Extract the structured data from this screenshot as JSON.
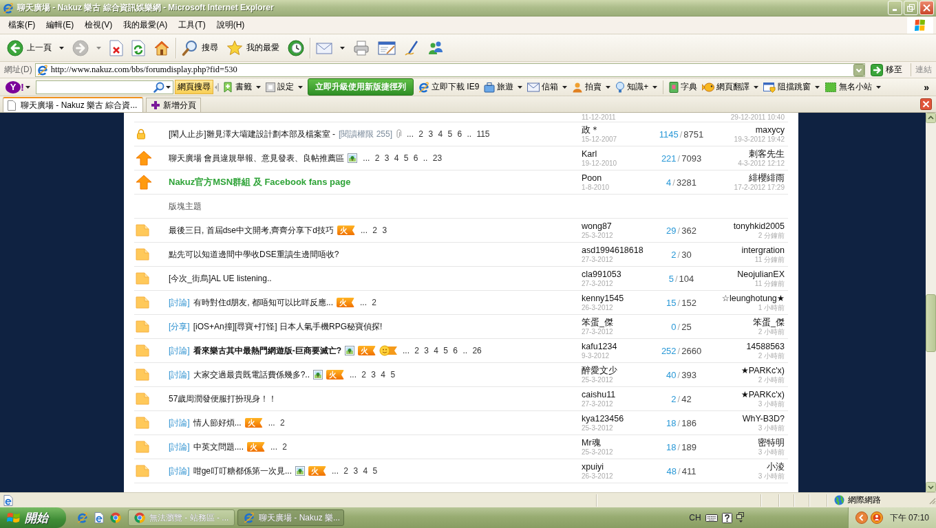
{
  "window": {
    "title": "聊天廣場 - Nakuz 樂古 綜合資訊娛樂網 - Microsoft Internet Explorer"
  },
  "menu_bar": {
    "items": [
      "檔案(F)",
      "編輯(E)",
      "檢視(V)",
      "我的最愛(A)",
      "工具(T)",
      "說明(H)"
    ]
  },
  "toolbar": {
    "groups": [
      [
        {
          "kind": "back",
          "label": "上一頁",
          "dropdown": true,
          "disabled": false
        },
        {
          "kind": "forward",
          "dropdown": true,
          "disabled": true
        },
        {
          "kind": "stop",
          "dropdown": false,
          "disabled": false
        },
        {
          "kind": "refresh",
          "dropdown": false,
          "disabled": false
        },
        {
          "kind": "home",
          "dropdown": false,
          "disabled": false
        }
      ],
      [
        {
          "kind": "search",
          "label": "搜尋",
          "dropdown": false,
          "disabled": false
        },
        {
          "kind": "favorites",
          "label": "我的最愛",
          "dropdown": false,
          "disabled": false
        },
        {
          "kind": "history",
          "dropdown": false,
          "disabled": false
        }
      ],
      [
        {
          "kind": "mail",
          "dropdown": true,
          "disabled": false
        },
        {
          "kind": "print",
          "dropdown": false,
          "disabled": false
        },
        {
          "kind": "edit",
          "dropdown": false,
          "disabled": false
        },
        {
          "kind": "discuss",
          "dropdown": false,
          "disabled": false
        },
        {
          "kind": "messenger",
          "dropdown": false,
          "disabled": false
        }
      ]
    ]
  },
  "address_bar": {
    "label": "網址(D)",
    "url": "http://www.nakuz.com/bbs/forumdisplay.php?fid=530",
    "go": "移至",
    "links": "連結"
  },
  "yahoo_toolbar": {
    "logo_letter": "Y",
    "logo_mark": "!",
    "search_button": "網頁搜尋",
    "groups": [
      [
        {
          "kind": "bookmarks",
          "label": "書籤",
          "dropdown": true
        },
        {
          "kind": "settings",
          "label": "設定",
          "dropdown": true
        },
        {
          "kind": "upgrade",
          "label": "立即升級使用新版捷徑列",
          "dropdown": false
        },
        {
          "kind": "ie9",
          "label": "立即下載 IE9",
          "dropdown": false
        },
        {
          "kind": "travel",
          "label": "旅遊",
          "dropdown": true
        },
        {
          "kind": "mail",
          "label": "信箱",
          "dropdown": true
        },
        {
          "kind": "auction",
          "label": "拍賣",
          "dropdown": true
        },
        {
          "kind": "knowledge",
          "label": "知識+",
          "dropdown": true
        }
      ],
      [
        {
          "kind": "dictionary",
          "label": "字典",
          "dropdown": false
        },
        {
          "kind": "translate",
          "label": "網頁翻譯",
          "dropdown": true
        },
        {
          "kind": "popup_blocker",
          "label": "阻擋跳窗",
          "dropdown": true
        },
        {
          "kind": "blog",
          "label": "無名小站",
          "dropdown": true
        }
      ]
    ],
    "more": "»"
  },
  "tab_bar": {
    "tabs": [
      {
        "label": "聊天廣場 - Nakuz 樂古 綜合資...",
        "selected": true
      }
    ],
    "new_tab": "新增分頁"
  },
  "forum": {
    "rows": [
      {
        "kind": "partial",
        "author_date": "11-12-2011",
        "last_time": "29-12-2011 10:40"
      },
      {
        "kind": "locked",
        "title": "[閑人止步]雛見澤大壩建設計劃本部及檔案室 -",
        "note": "[閱讀權限 255]",
        "badges": [
          {
            "kind": "attachment"
          }
        ],
        "pages": "... 2 3 4 5 6 .. 115",
        "author": "政＊",
        "date": "15-12-2007",
        "replies": "1145",
        "slash": "/",
        "views": "8751",
        "last_user": "maxycy",
        "last_time": "19-3-2012 19:42"
      },
      {
        "kind": "pinned",
        "title": "聊天廣場 會員違規舉報、意見發表、良帖推薦區",
        "badges": [
          {
            "kind": "image"
          }
        ],
        "pages": "... 2 3 4 5 6 .. 23",
        "author": "Karl",
        "date": "19-12-2010",
        "replies": "221",
        "slash": "/",
        "views": "7093",
        "last_user": "刺客先生",
        "last_time": "4-3-2012 12:12"
      },
      {
        "kind": "pinned_highlighted",
        "title": "Nakuz官方MSN群組 及 Facebook fans page",
        "author": "Poon",
        "date": "1-8-2010",
        "replies": "4",
        "slash": "/",
        "views": "3281",
        "last_user": "緋櫻緋雨",
        "last_time": "17-2-2012 17:29"
      },
      {
        "kind": "section",
        "label": "版塊主題"
      },
      {
        "kind": "topic",
        "title": "最後三日, 首屆dse中文開考,齊齊分享下d技巧",
        "badges": [
          {
            "kind": "hot",
            "text": "火"
          }
        ],
        "pages": "... 2 3",
        "author": "wong87",
        "date": "25-3-2012",
        "replies": "29",
        "slash": "/",
        "views": "362",
        "last_user": "tonyhkid2005",
        "last_time": "2 分鐘前"
      },
      {
        "kind": "topic",
        "title": "點先可以知道邊間中學收DSE重讀生邊間唔收?",
        "author": "asd1994618618",
        "date": "27-3-2012",
        "replies": "2",
        "slash": "/",
        "views": "30",
        "last_user": "intergration",
        "last_time": "11 分鐘前"
      },
      {
        "kind": "topic",
        "title": "[今次_街烏]AL UE listening..",
        "author": "cla991053",
        "date": "27-3-2012",
        "replies": "5",
        "slash": "/",
        "views": "104",
        "last_user": "NeojulianEX",
        "last_time": "11 分鐘前"
      },
      {
        "kind": "topic",
        "tag": "[討論]",
        "title": "有時對住d朋友, 都唔知可以比咩反應...",
        "badges": [
          {
            "kind": "hot",
            "text": "火"
          }
        ],
        "pages": "... 2",
        "author": "kenny1545",
        "date": "26-3-2012",
        "replies": "15",
        "slash": "/",
        "views": "152",
        "last_user": "☆leunghotung★",
        "last_time": "1 小時前"
      },
      {
        "kind": "topic",
        "tag": "[分享]",
        "title": "[iOS+An撞][尋寶+打怪] 日本人氣手機RPG秘寶偵探!",
        "author": "笨蛋_傑",
        "date": "27-3-2012",
        "replies": "0",
        "slash": "/",
        "views": "25",
        "last_user": "笨蛋_傑",
        "last_time": "2 小時前"
      },
      {
        "kind": "bold_topic",
        "tag": "[討論]",
        "title": "看來樂古其中最熱門網遊版-巨商要滅亡?",
        "badges": [
          {
            "kind": "image"
          },
          {
            "kind": "hot",
            "text": "火"
          },
          {
            "kind": "smiley"
          }
        ],
        "pages": "... 2 3 4 5 6 .. 26",
        "author": "kafu1234",
        "date": "9-3-2012",
        "replies": "252",
        "slash": "/",
        "views": "2660",
        "last_user": "14588563",
        "last_time": "2 小時前"
      },
      {
        "kind": "topic",
        "tag": "[討論]",
        "title": "大家交過最貴既電話費係幾多?..",
        "badges": [
          {
            "kind": "image"
          },
          {
            "kind": "hot",
            "text": "火"
          }
        ],
        "pages": "... 2 3 4 5",
        "author": "醉愛文少",
        "date": "25-3-2012",
        "replies": "40",
        "slash": "/",
        "views": "393",
        "last_user": "★PARKc'x)",
        "last_time": "2 小時前"
      },
      {
        "kind": "topic",
        "title": "57歲周潤發便服打扮現身！！",
        "author": "caishu11",
        "date": "27-3-2012",
        "replies": "2",
        "slash": "/",
        "views": "42",
        "last_user": "★PARKc'x)",
        "last_time": "3 小時前"
      },
      {
        "kind": "topic",
        "tag": "[討論]",
        "title": "情人節好煩...",
        "badges": [
          {
            "kind": "hot",
            "text": "火"
          }
        ],
        "pages": "... 2",
        "author": "kya123456",
        "date": "25-3-2012",
        "replies": "18",
        "slash": "/",
        "views": "186",
        "last_user": "WhY-B3D?",
        "last_time": "3 小時前"
      },
      {
        "kind": "topic",
        "tag": "[討論]",
        "title": "中英文問題....",
        "badges": [
          {
            "kind": "hot",
            "text": "火"
          }
        ],
        "pages": "... 2",
        "author": "Mr魂",
        "date": "25-3-2012",
        "replies": "18",
        "slash": "/",
        "views": "189",
        "last_user": "密特明",
        "last_time": "3 小時前"
      },
      {
        "kind": "topic",
        "tag": "[討論]",
        "title": "咁ge叮叮糖都係第一次見...",
        "badges": [
          {
            "kind": "image"
          },
          {
            "kind": "hot",
            "text": "火"
          }
        ],
        "pages": "... 2 3 4 5",
        "author": "xpuiyi",
        "date": "26-3-2012",
        "replies": "48",
        "slash": "/",
        "views": "411",
        "last_user": "小淩",
        "last_time": "3 小時前"
      }
    ]
  },
  "status_bar": {
    "zone": "網際網路"
  },
  "taskbar": {
    "start": "開始",
    "quick_launch": [
      {
        "kind": "ie"
      },
      {
        "kind": "ie_page"
      },
      {
        "kind": "chrome"
      }
    ],
    "tasks": [
      {
        "kind": "chrome",
        "label": "無法瀏覽 - 站務區 - ...",
        "selected": false
      },
      {
        "kind": "ie",
        "label": "聊天廣場 - Nakuz 樂...",
        "selected": true
      }
    ],
    "tray": {
      "language": "CH",
      "clock": "下午 07:10"
    }
  }
}
